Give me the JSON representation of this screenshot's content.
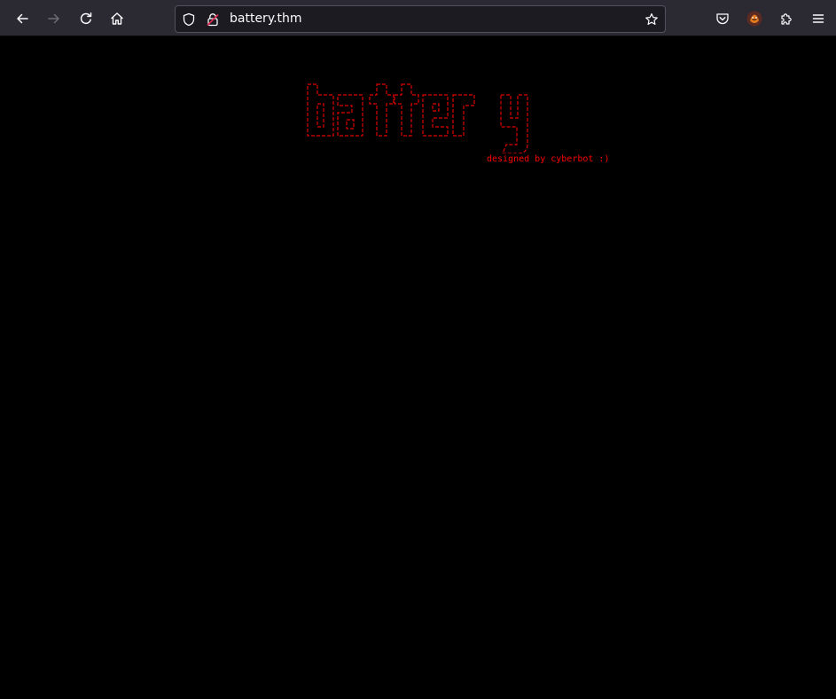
{
  "browser": {
    "url": "battery.thm",
    "icons": {
      "back": "arrow-left-icon",
      "forward": "arrow-right-icon",
      "reload": "reload-icon",
      "home": "home-icon",
      "tracking": "shield-icon",
      "lock": "lock-icon",
      "bookmark": "star-icon",
      "pocket": "pocket-icon",
      "account": "avatar-icon",
      "extensions": "puzzle-icon",
      "menu": "hamburger-menu-icon"
    }
  },
  "page": {
    "logo_text": "battery",
    "credit": "designed by cyberbot :)",
    "text_color": "#ff0000",
    "background": "#000000"
  }
}
